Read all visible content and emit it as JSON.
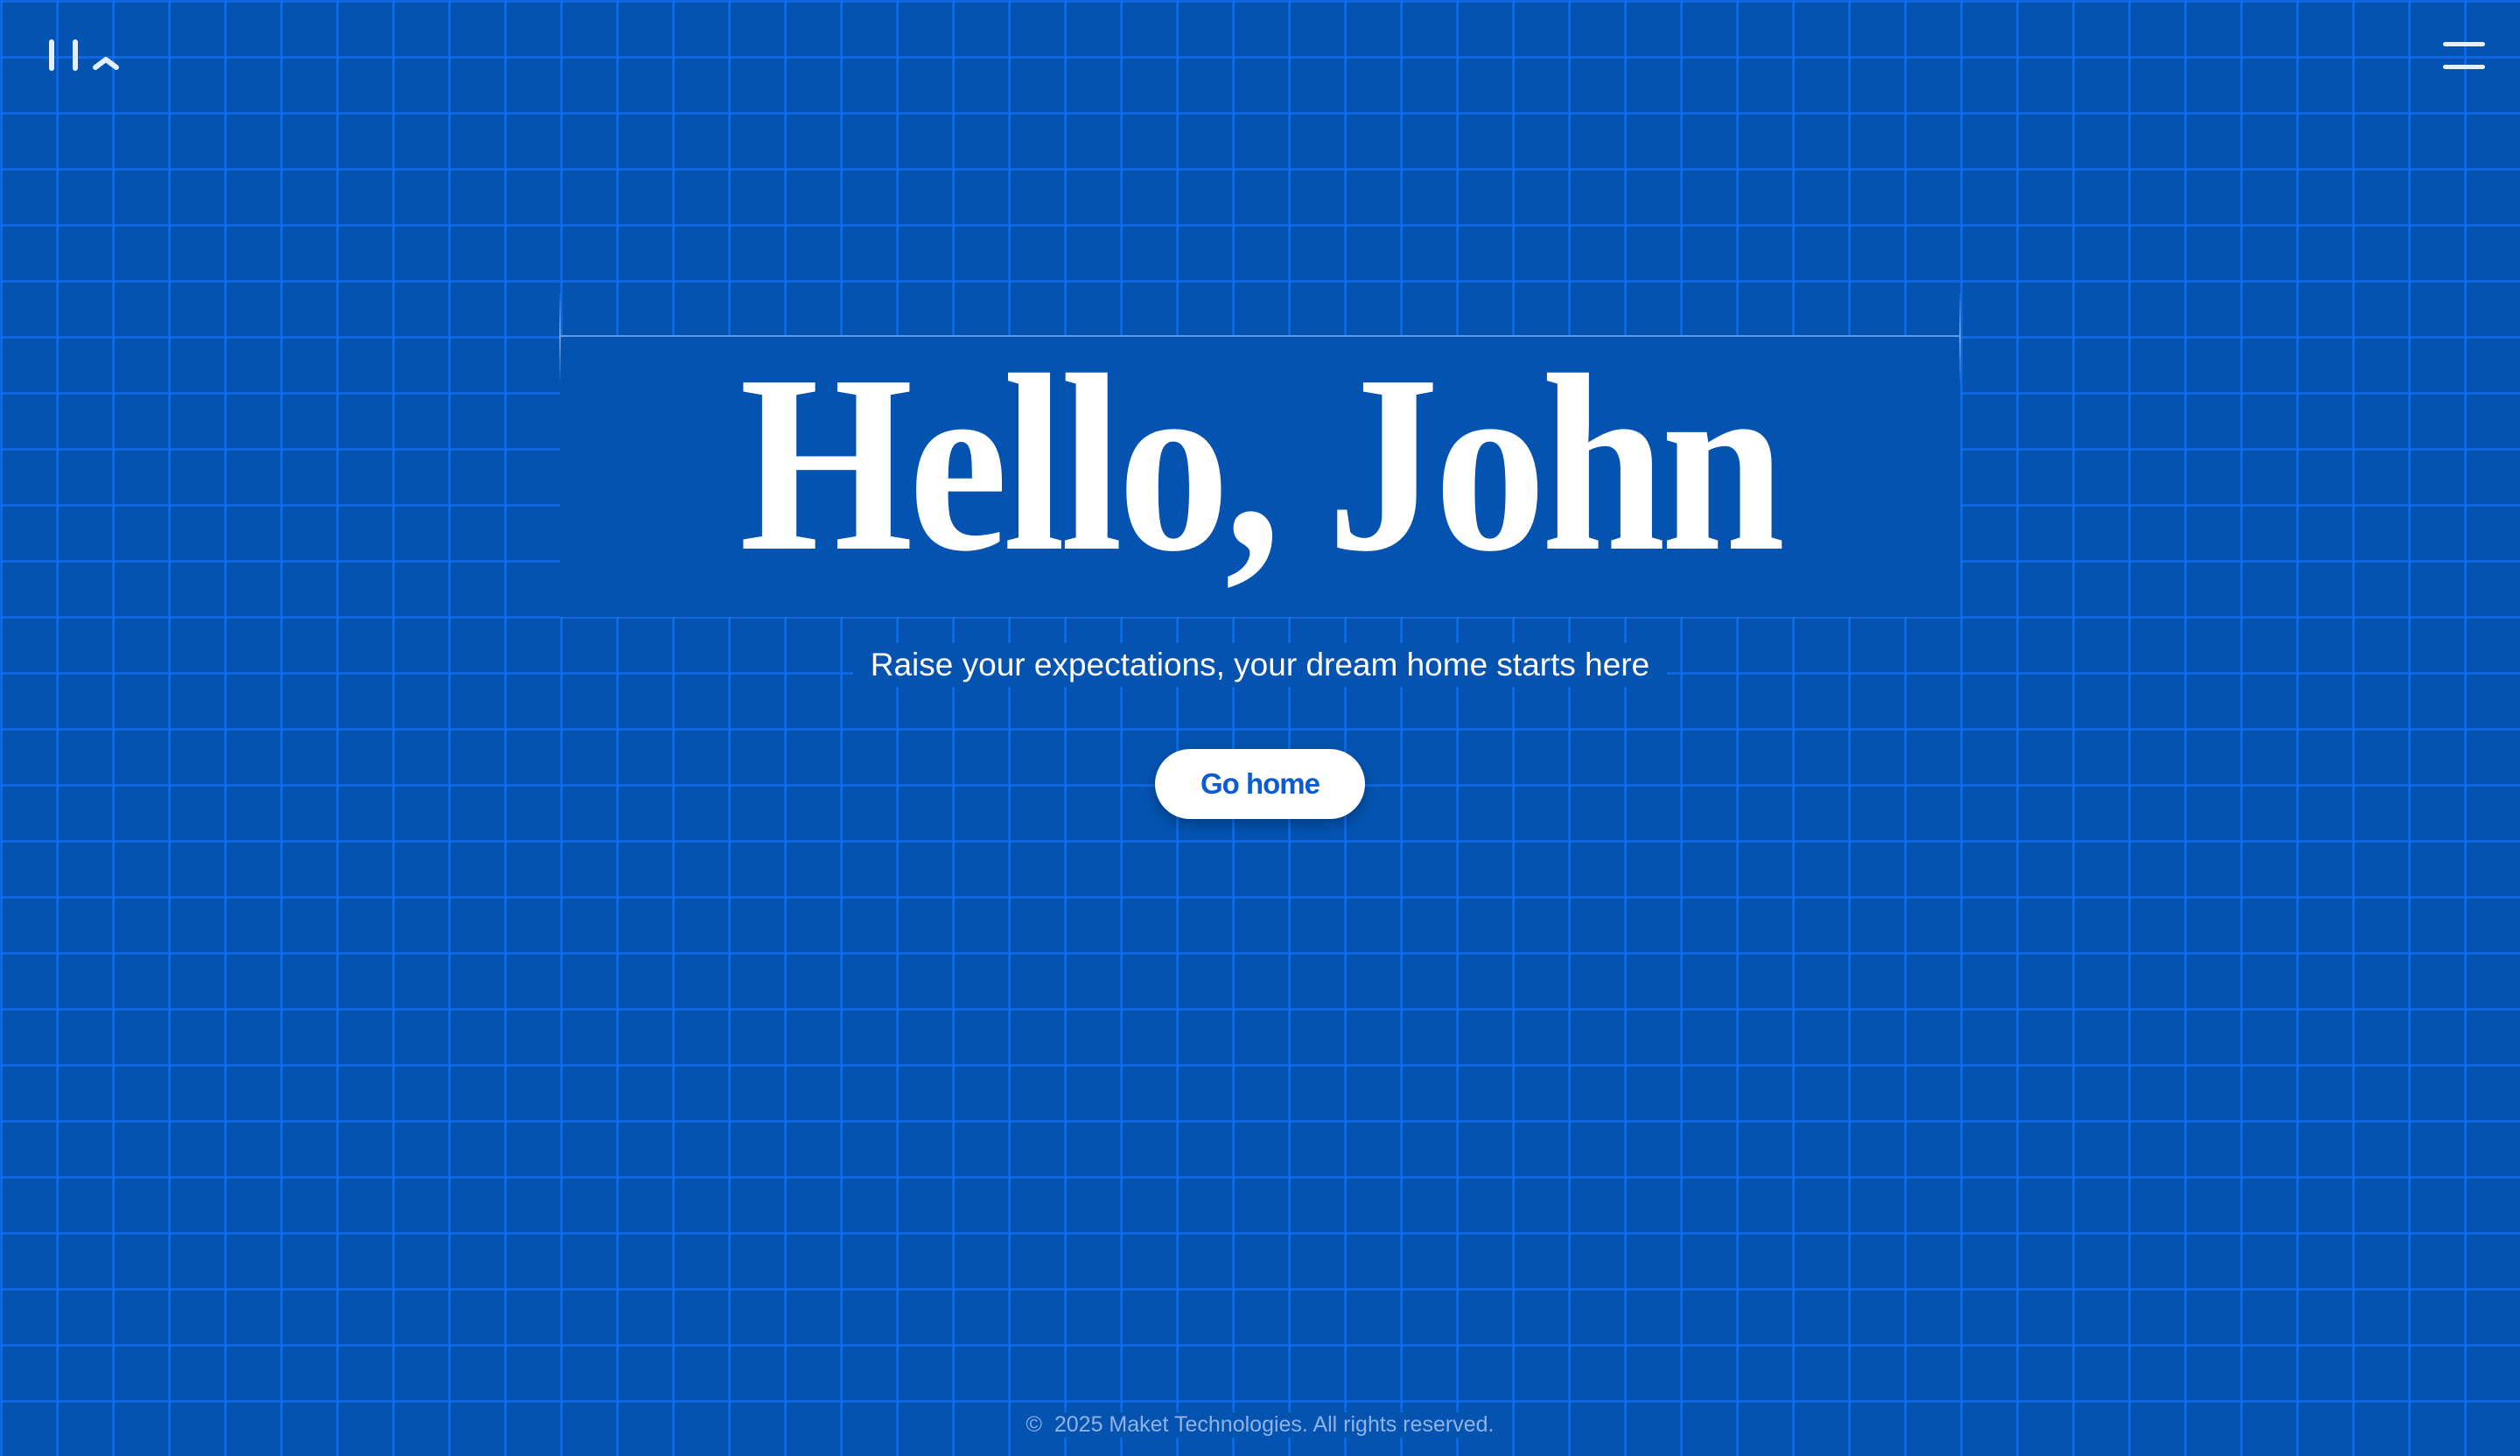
{
  "header": {
    "logo_icon": "maket-logo-icon",
    "menu_icon": "hamburger-menu-icon"
  },
  "hero": {
    "title": "Hello, John",
    "subtitle": "Raise your expectations, your dream home starts here",
    "button_label": "Go home"
  },
  "footer": {
    "copyright_symbol": "©",
    "text": "2025 Maket Technologies. All rights reserved."
  },
  "colors": {
    "background": "#0453b0",
    "grid": "#146eeb",
    "button_text": "#0b5bd3"
  }
}
